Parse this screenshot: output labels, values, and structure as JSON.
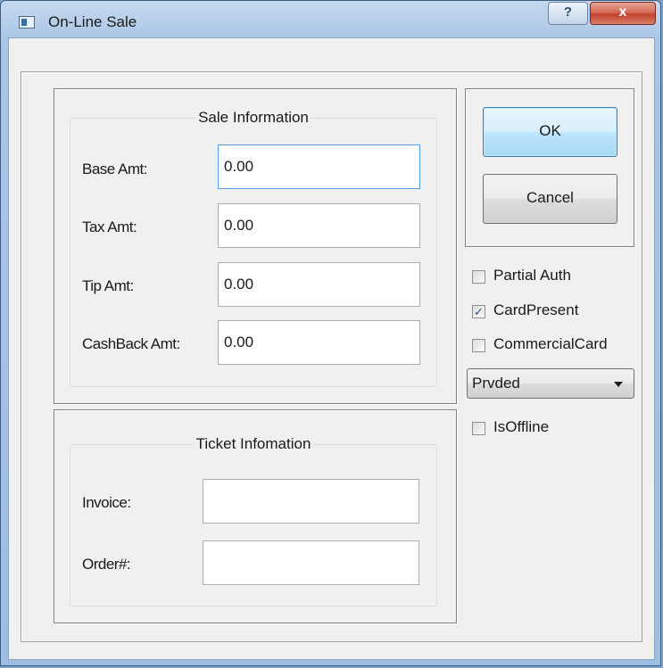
{
  "window": {
    "title": "On-Line Sale",
    "help_glyph": "?",
    "close_glyph": "x"
  },
  "sale_info": {
    "title": "Sale Information",
    "base_label": "Base Amt:",
    "base_value": "0.00",
    "tax_label": "Tax Amt:",
    "tax_value": "0.00",
    "tip_label": "Tip Amt:",
    "tip_value": "0.00",
    "cashback_label": "CashBack Amt:",
    "cashback_value": "0.00"
  },
  "ticket_info": {
    "title": "Ticket Infomation",
    "invoice_label": "Invoice:",
    "invoice_value": "",
    "order_label": "Order#:",
    "order_value": ""
  },
  "buttons": {
    "ok": "OK",
    "cancel": "Cancel"
  },
  "options": {
    "partial_auth": {
      "label": "Partial Auth",
      "checked": false
    },
    "card_present": {
      "label": "CardPresent",
      "checked": true
    },
    "commercial_card": {
      "label": "CommercialCard",
      "checked": false
    },
    "combo_value": "Prvded",
    "is_offline": {
      "label": "IsOffline",
      "checked": false
    }
  },
  "icons": {
    "app": "app-icon",
    "help": "help-icon",
    "close": "close-icon",
    "check": "checkmark-icon",
    "dropdown": "chevron-down-icon"
  },
  "colors": {
    "titlebar": "#a9c6e6",
    "close_button": "#c1412b",
    "ok_button": "#bee6fd",
    "focus_border": "#569de5",
    "dialog_bg": "#f0f0f0"
  }
}
